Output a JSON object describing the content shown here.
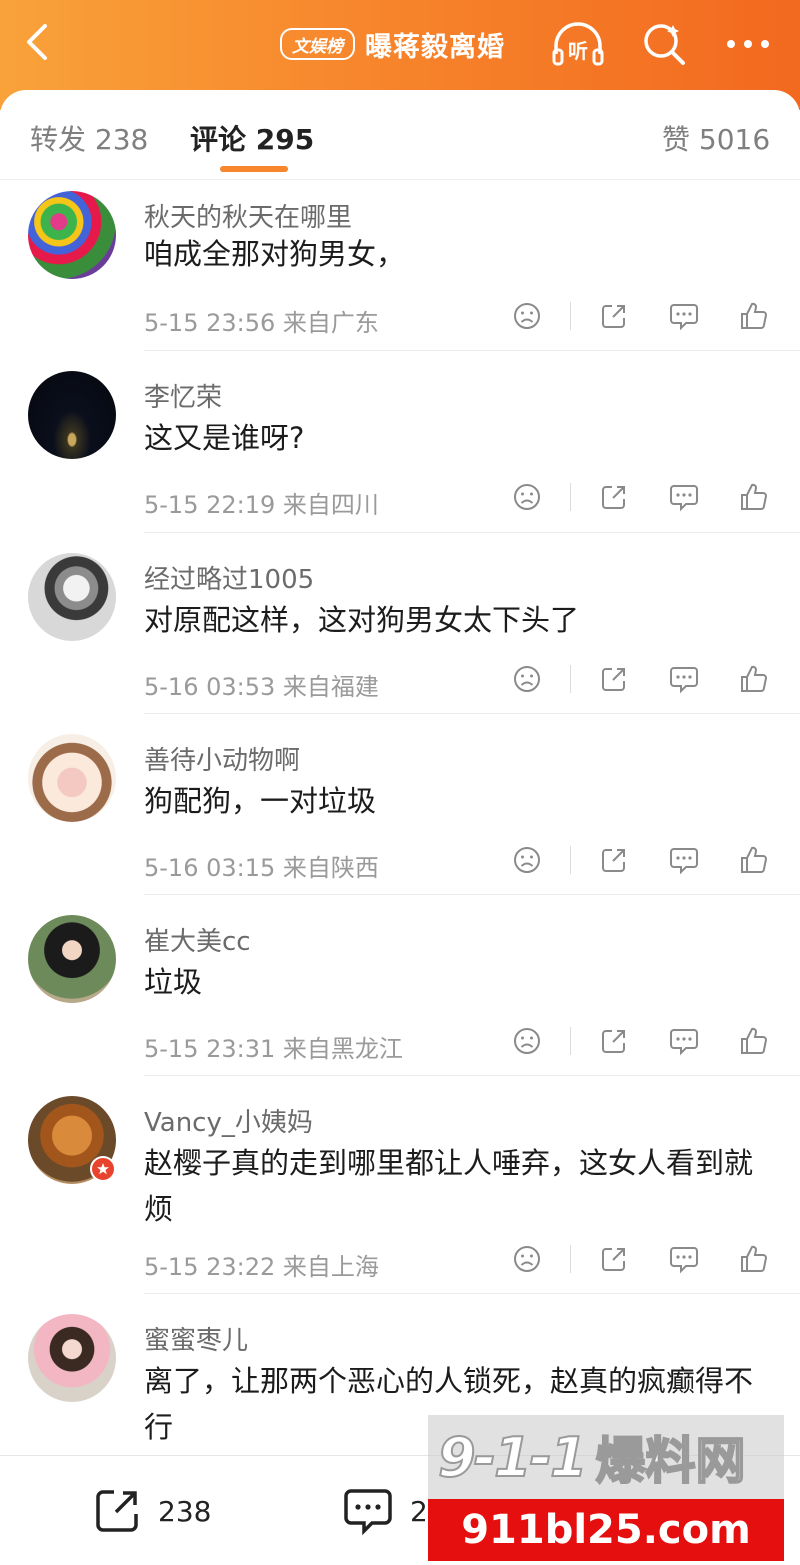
{
  "header": {
    "badge": "文娱榜",
    "topic": "曝蒋毅离婚",
    "listen_label": "听"
  },
  "tabs": {
    "repost": "转发 238",
    "comments": "评论 295",
    "likes": "赞 5016"
  },
  "comments": [
    {
      "name": "秋天的秋天在哪里",
      "text": "咱成全那对狗男女，",
      "meta": "5-15 23:56 来自广东"
    },
    {
      "name": "李忆荣",
      "text": "这又是谁呀?",
      "meta": "5-15 22:19 来自四川"
    },
    {
      "name": "经过略过1005",
      "text": "对原配这样，这对狗男女太下头了",
      "meta": "5-16 03:53 来自福建"
    },
    {
      "name": "善待小动物啊",
      "text": "狗配狗，一对垃圾",
      "meta": "5-16 03:15 来自陕西"
    },
    {
      "name": "崔大美cc",
      "text": "垃圾",
      "meta": "5-15 23:31 来自黑龙江"
    },
    {
      "name": "Vancy_小姨妈",
      "text": "赵樱子真的走到哪里都让人唾弃，这女人看到就烦",
      "meta": "5-15 23:22 来自上海"
    },
    {
      "name": "蜜蜜枣儿",
      "text": "离了，让那两个恶心的人锁死，赵真的疯癫得不行",
      "meta": ""
    }
  ],
  "bottom_bar": {
    "repost_count": "238",
    "comment_count": "29"
  },
  "watermark": {
    "logo": "9-1-1",
    "cn": "爆料网",
    "url": "911bl25.com"
  },
  "colors": {
    "accent": "#f7862c",
    "header_start": "#f9a23a",
    "header_end": "#f2691f",
    "watermark_red": "#e50f0f"
  }
}
